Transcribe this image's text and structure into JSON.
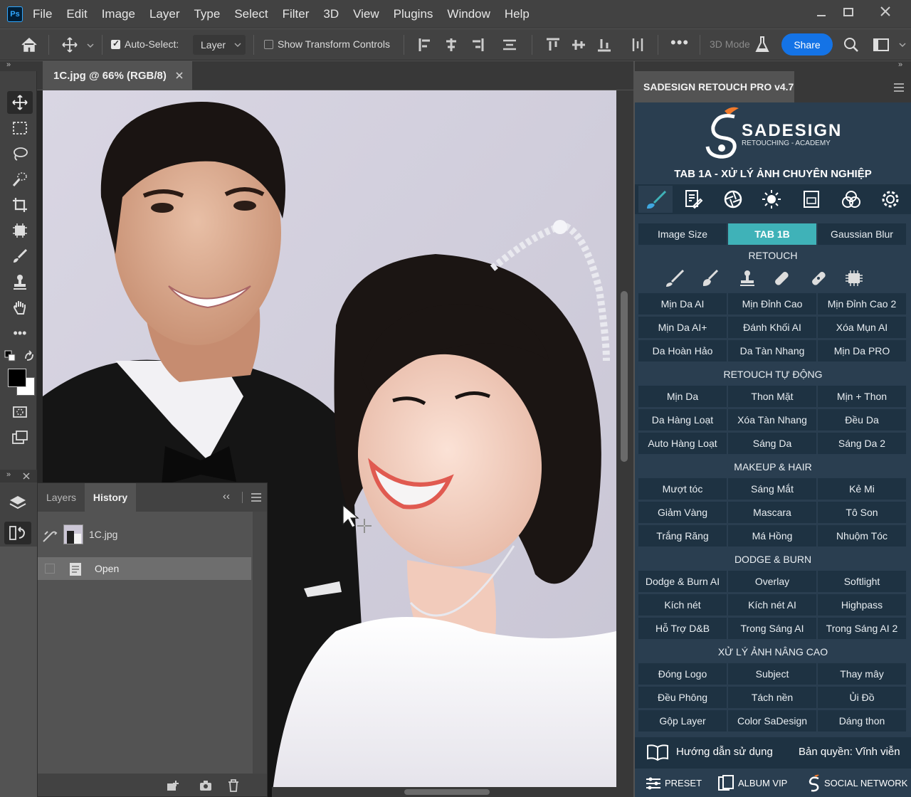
{
  "app": {
    "logo": "Ps"
  },
  "menu": [
    "File",
    "Edit",
    "Image",
    "Layer",
    "Type",
    "Select",
    "Filter",
    "3D",
    "View",
    "Plugins",
    "Window",
    "Help"
  ],
  "options": {
    "auto_select_label": "Auto-Select:",
    "auto_select_checked": true,
    "layer_select": "Layer",
    "show_transform_label": "Show Transform Controls",
    "mode_3d": "3D Mode",
    "share": "Share"
  },
  "document": {
    "tab_title": "1C.jpg @ 66% (RGB/8)"
  },
  "history_panel": {
    "tabs": [
      "Layers",
      "History"
    ],
    "active_tab": "History",
    "snapshot": "1C.jpg",
    "states": [
      "Open"
    ]
  },
  "plugin": {
    "title": "SADESIGN RETOUCH PRO v4.7",
    "brand": "SADESIGN",
    "brand_sub": "RETOUCHING - ACADEMY",
    "tab_heading": "TAB 1A - XỬ LÝ ẢNH CHUYÊN NGHIỆP",
    "top_buttons": [
      "Image Size",
      "TAB 1B",
      "Gaussian Blur"
    ],
    "sections": [
      {
        "title": "RETOUCH",
        "buttons": [
          "Mịn Da AI",
          "Mịn Đỉnh Cao",
          "Mịn Đỉnh Cao 2",
          "Mịn Da AI+",
          "Đánh Khối AI",
          "Xóa Mụn AI",
          "Da Hoàn Hảo",
          "Da Tàn Nhang",
          "Mịn Da PRO"
        ]
      },
      {
        "title": "RETOUCH TỰ ĐỘNG",
        "buttons": [
          "Mịn Da",
          "Thon Mặt",
          "Mịn + Thon",
          "Da Hàng Loạt",
          "Xóa Tàn Nhang",
          "Đều Da",
          "Auto Hàng Loạt",
          "Sáng Da",
          "Sáng Da 2"
        ]
      },
      {
        "title": "MAKEUP & HAIR",
        "buttons": [
          "Mượt tóc",
          "Sáng Mắt",
          "Kẻ Mi",
          "Giảm Vàng",
          "Mascara",
          "Tô Son",
          "Trắng Răng",
          "Má Hồng",
          "Nhuộm Tóc"
        ]
      },
      {
        "title": "DODGE & BURN",
        "buttons": [
          "Dodge & Burn AI",
          "Overlay",
          "Softlight",
          "Kích nét",
          "Kích nét AI",
          "Highpass",
          "Hỗ Trợ D&B",
          "Trong Sáng AI",
          "Trong Sáng AI 2"
        ]
      },
      {
        "title": "XỬ LÝ ẢNH NÂNG CAO",
        "buttons": [
          "Đóng Logo",
          "Subject",
          "Thay mây",
          "Đều Phông",
          "Tách nền",
          "Ủi Đồ",
          "Gộp Layer",
          "Color SaDesign",
          "Dáng thon"
        ]
      }
    ],
    "guide": "Hướng dẫn sử dụng",
    "license": "Bản quyền: Vĩnh viễn",
    "footer": [
      "PRESET",
      "ALBUM VIP",
      "SOCIAL NETWORK"
    ],
    "accent": "#3fb2b8",
    "panel_bg": "#2a3e50",
    "button_bg": "#1e3242"
  }
}
